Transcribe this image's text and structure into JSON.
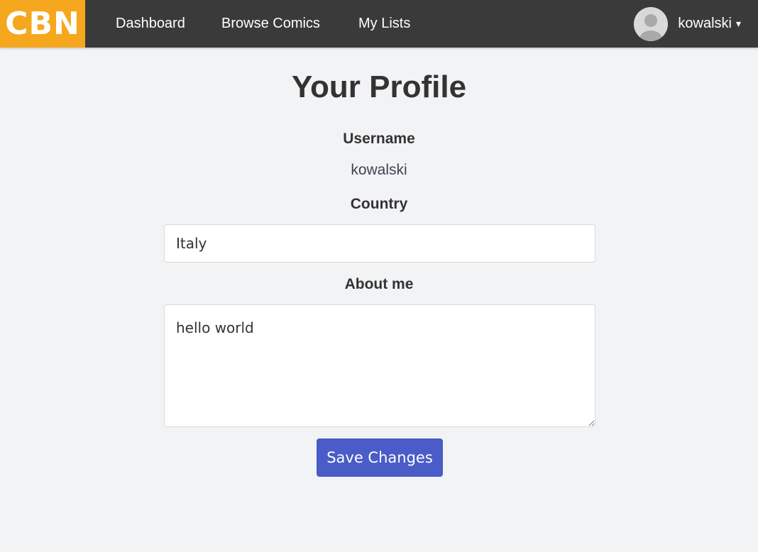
{
  "nav": {
    "logo_text": "CBN",
    "links": [
      "Dashboard",
      "Browse Comics",
      "My Lists"
    ],
    "user": {
      "name": "kowalski",
      "caret": "▾"
    },
    "colors": {
      "bar": "#3a3a3a",
      "logo": "#f5a81d"
    }
  },
  "profile": {
    "title": "Your Profile",
    "username_label": "Username",
    "username_value": "kowalski",
    "country_label": "Country",
    "country_value": "Italy",
    "about_label": "About me",
    "about_value": "hello world",
    "save_label": "Save Changes",
    "save_color": "#4a5cc7"
  }
}
